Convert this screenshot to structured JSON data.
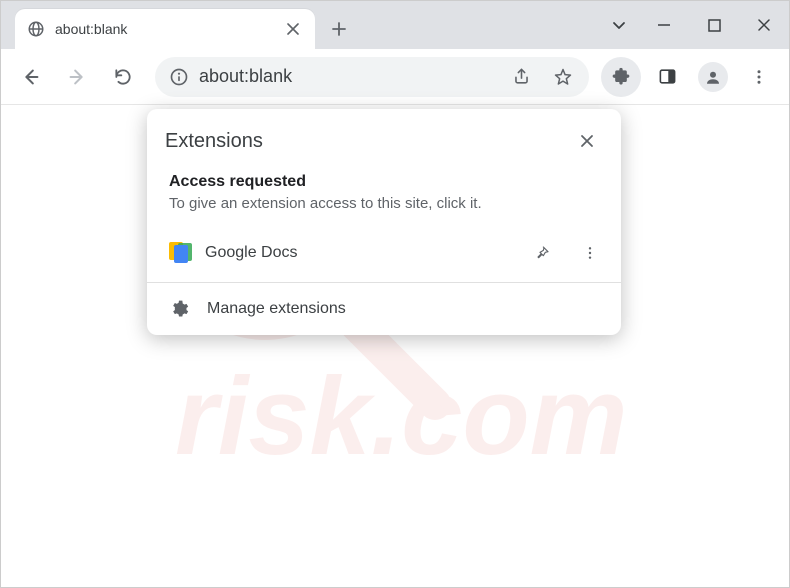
{
  "tab": {
    "title": "about:blank"
  },
  "omnibox": {
    "url": "about:blank"
  },
  "ext_popup": {
    "title": "Extensions",
    "section_title": "Access requested",
    "section_desc": "To give an extension access to this site, click it.",
    "items": [
      {
        "name": "Google Docs"
      }
    ],
    "manage_label": "Manage extensions"
  }
}
